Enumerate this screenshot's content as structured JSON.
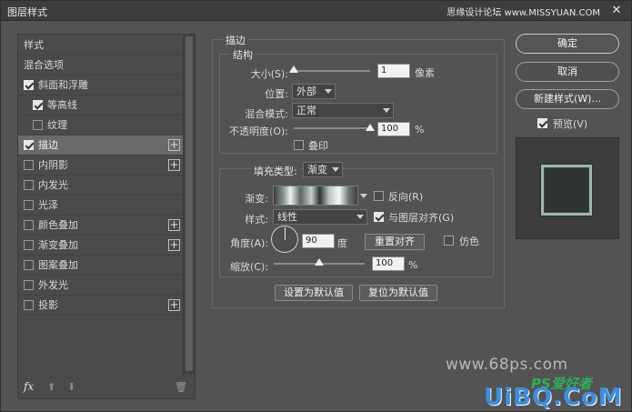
{
  "window": {
    "title": "图层样式",
    "top_watermark": "思缘设计论坛 www.MISSYUAN.COM",
    "close": "✕"
  },
  "left_panel": {
    "items": [
      {
        "label": "样式",
        "checkbox": false,
        "checked": false,
        "plus": false,
        "selected": false,
        "indent": false
      },
      {
        "label": "混合选项",
        "checkbox": false,
        "checked": false,
        "plus": false,
        "selected": false,
        "indent": false
      },
      {
        "label": "斜面和浮雕",
        "checkbox": true,
        "checked": true,
        "plus": false,
        "selected": false,
        "indent": false
      },
      {
        "label": "等高线",
        "checkbox": true,
        "checked": true,
        "plus": false,
        "selected": false,
        "indent": true
      },
      {
        "label": "纹理",
        "checkbox": true,
        "checked": false,
        "plus": false,
        "selected": false,
        "indent": true
      },
      {
        "label": "描边",
        "checkbox": true,
        "checked": true,
        "plus": true,
        "selected": true,
        "indent": false
      },
      {
        "label": "内阴影",
        "checkbox": true,
        "checked": false,
        "plus": true,
        "selected": false,
        "indent": false
      },
      {
        "label": "内发光",
        "checkbox": true,
        "checked": false,
        "plus": false,
        "selected": false,
        "indent": false
      },
      {
        "label": "光泽",
        "checkbox": true,
        "checked": false,
        "plus": false,
        "selected": false,
        "indent": false
      },
      {
        "label": "颜色叠加",
        "checkbox": true,
        "checked": false,
        "plus": true,
        "selected": false,
        "indent": false
      },
      {
        "label": "渐变叠加",
        "checkbox": true,
        "checked": false,
        "plus": true,
        "selected": false,
        "indent": false
      },
      {
        "label": "图案叠加",
        "checkbox": true,
        "checked": false,
        "plus": false,
        "selected": false,
        "indent": false
      },
      {
        "label": "外发光",
        "checkbox": true,
        "checked": false,
        "plus": false,
        "selected": false,
        "indent": false
      },
      {
        "label": "投影",
        "checkbox": true,
        "checked": false,
        "plus": true,
        "selected": false,
        "indent": false
      }
    ],
    "footer": {
      "fx": "fx",
      "up": "⬆",
      "down": "⬇",
      "trash": "🗑"
    }
  },
  "stroke": {
    "section_title": "描边",
    "structure_title": "结构",
    "size_label": "大小(S):",
    "size_value": "1",
    "size_unit": "像素",
    "size_fraction": 0.0,
    "position_label": "位置:",
    "position_value": "外部",
    "blend_label": "混合模式:",
    "blend_value": "正常",
    "opacity_label": "不透明度(O):",
    "opacity_value": "100",
    "opacity_unit": "%",
    "opacity_fraction": 1.0,
    "overprint_label": "叠印",
    "overprint_checked": false,
    "fill_type_label": "填充类型:",
    "fill_type_value": "渐变",
    "gradient_label": "渐变:",
    "reverse_label": "反向(R)",
    "reverse_checked": false,
    "style_label": "样式:",
    "style_value": "线性",
    "align_label": "与图层对齐(G)",
    "align_checked": true,
    "angle_label": "角度(A):",
    "angle_value": "90",
    "angle_unit": "度",
    "reset_align_label": "重置对齐",
    "dither_label": "仿色",
    "dither_checked": false,
    "scale_label": "缩放(C):",
    "scale_value": "100",
    "scale_unit": "%",
    "scale_fraction": 0.5,
    "make_default_label": "设置为默认值",
    "reset_default_label": "复位为默认值"
  },
  "right": {
    "ok_label": "确定",
    "cancel_label": "取消",
    "new_style_label": "新建样式(W)...",
    "preview_label": "预览(V)",
    "preview_checked": true
  },
  "watermarks": {
    "site": "www.68ps.com",
    "ps": "PS爱好者",
    "uibq": "UiBQ.CoM"
  }
}
